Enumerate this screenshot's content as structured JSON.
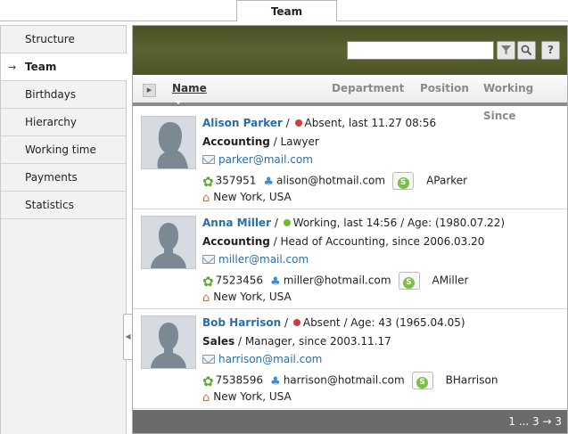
{
  "top_tab": {
    "label": "Team"
  },
  "sidebar": {
    "items": [
      {
        "label": "Structure",
        "active": false
      },
      {
        "label": "Team",
        "active": true
      },
      {
        "label": "Birthdays",
        "active": false
      },
      {
        "label": "Hierarchy",
        "active": false
      },
      {
        "label": "Working time",
        "active": false
      },
      {
        "label": "Payments",
        "active": false
      },
      {
        "label": "Statistics",
        "active": false
      }
    ],
    "active_marker": "→"
  },
  "search": {
    "placeholder": "",
    "value": ""
  },
  "columns": [
    {
      "label": "Name",
      "sorted": true
    },
    {
      "label": "Department",
      "sorted": false
    },
    {
      "label": "Position",
      "sorted": false
    },
    {
      "label": "Working Since",
      "sorted": false
    }
  ],
  "employees": [
    {
      "name": "Alison Parker",
      "status": "Absent, last 11.27 08:56",
      "status_color": "#d63b3b",
      "department": "Accounting",
      "position": "Lawyer",
      "email": "parker@mail.com",
      "phone": "357951",
      "msn": "alison@hotmail.com",
      "skype": "AParker",
      "location": "New York, USA",
      "gender": "female"
    },
    {
      "name": "Anna Miller",
      "status": "Working, last 14:56 / Age: (1980.07.22)",
      "status_color": "#6abf2f",
      "department": "Accounting",
      "position": "Head of Accounting, since 2006.03.20",
      "email": "miller@mail.com",
      "phone": "7523456",
      "msn": "miller@hotmail.com",
      "skype": "AMiller",
      "location": "New York, USA",
      "gender": "male"
    },
    {
      "name": "Bob Harrison",
      "status": "Absent / Age: 43 (1965.04.05)",
      "status_color": "#d63b3b",
      "department": "Sales",
      "position": "Manager, since 2003.11.17",
      "email": "harrison@mail.com",
      "phone": "7538596",
      "msn": "harrison@hotmail.com",
      "skype": "BHarrison",
      "location": "New York, USA",
      "gender": "male"
    }
  ],
  "pagination": {
    "text": "1 ... 3",
    "next": "→ 3"
  },
  "icons": {
    "filter": "filter-icon",
    "search": "search-icon",
    "help": "help-icon",
    "mail": "mail-icon",
    "phone": "phone-gear-icon",
    "msn": "msn-icon",
    "skype": "skype-icon",
    "home": "home-icon"
  }
}
